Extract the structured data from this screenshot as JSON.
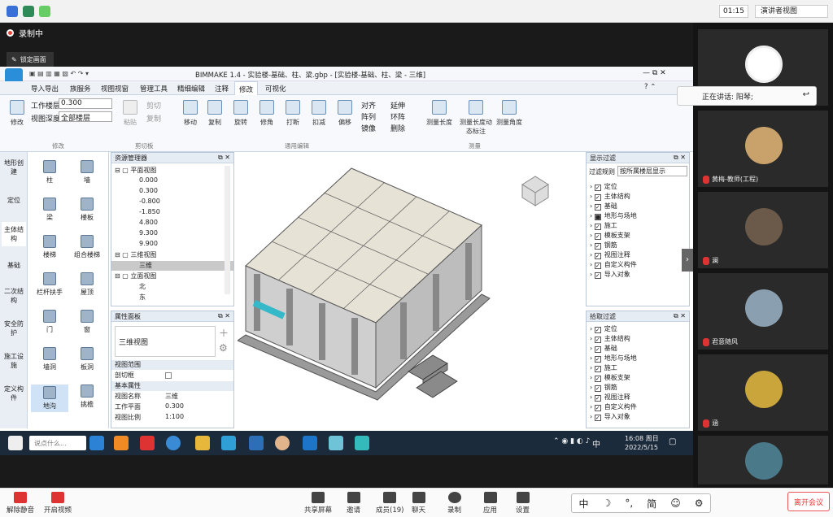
{
  "meeting": {
    "recording_label": "录制中",
    "lock_label": "锁定画面",
    "time": "01:15",
    "view_mode": "演讲者视图",
    "speaking_label": "正在讲话: 阳琴;",
    "leave_label": "离开会议",
    "chat_placeholder": "说点什么...",
    "bottom": {
      "mute": "解除静音",
      "video": "开启视频",
      "share": "共享屏幕",
      "invite": "邀请",
      "members": "成员(19)",
      "chat": "聊天",
      "record": "录制",
      "apps": "应用",
      "settings": "设置"
    },
    "ime": [
      "中",
      "☽",
      "°,",
      "简",
      "☺",
      "⚙"
    ],
    "participants": [
      {
        "name": "",
        "color": "#c0392b"
      },
      {
        "name": "黄梅-教师(工程)",
        "color": "#c8a26a"
      },
      {
        "name": "澜",
        "color": "#6b5a4a"
      },
      {
        "name": "君意随风",
        "color": "#8aa0b0"
      },
      {
        "name": "涵",
        "color": "#c9a53c"
      },
      {
        "name": "",
        "color": "#4a7a8a"
      }
    ]
  },
  "app": {
    "title": "BIMMAKE 1.4 - 实验楼-基础、柱、梁.gbp - [实验楼-基础、柱、梁 - 三维]",
    "menu": [
      "导入导出",
      "族服务",
      "视图视窗",
      "管理工具",
      "精细编辑",
      "注释",
      "修改",
      "可视化"
    ],
    "ribbon": {
      "modify": "修改",
      "work_layer_label": "工作楼层",
      "work_layer_value": "0.300",
      "view_depth_label": "视图深度",
      "view_depth_value": "全部楼层",
      "paste": "粘贴",
      "cut": "剪切",
      "copy_small": "复制",
      "tools": [
        "移动",
        "复制",
        "旋转",
        "修角",
        "打断",
        "扣减",
        "偏移"
      ],
      "edit_small": [
        "对齐",
        "阵列",
        "镜像",
        "延伸",
        "环阵",
        "删除"
      ],
      "measure": [
        "测量长度",
        "测量长度动态标注",
        "测量角度"
      ],
      "groups": [
        "修改",
        "剪切板",
        "通用编辑",
        "测量"
      ]
    },
    "vtabs": [
      "地形创建",
      "定位",
      "主体结构",
      "基础",
      "二次结构",
      "安全防护",
      "施工设施",
      "定义构件"
    ],
    "palette": [
      "柱",
      "墙",
      "梁",
      "楼板",
      "楼梯",
      "组合楼梯",
      "栏杆扶手",
      "屋顶",
      "门",
      "窗",
      "墙洞",
      "板洞",
      "地沟",
      "挑檐"
    ],
    "resource": {
      "title": "资源管理器",
      "plan": "平面视图",
      "levels": [
        "0.000",
        "0.300",
        "-0.800",
        "-1.850",
        "4.800",
        "9.300",
        "9.900"
      ],
      "threeD": "三维视图",
      "threeD_item": "三维",
      "elev": "立面视图",
      "elev_items": [
        "北",
        "东"
      ]
    },
    "props": {
      "title": "属性面板",
      "view_type": "三维视图",
      "section_view": "视图范围",
      "cut_box": "剖切框",
      "section_basic": "基本属性",
      "rows": [
        {
          "k": "视图名称",
          "v": "三维"
        },
        {
          "k": "工作平面",
          "v": "0.300"
        },
        {
          "k": "视图比例",
          "v": "1:100"
        }
      ]
    },
    "display_filter": {
      "title": "显示过滤",
      "rule_label": "过滤规则",
      "rule_value": "按所属楼层显示",
      "items": [
        "定位",
        "主体结构",
        "基础",
        "地形与场地",
        "施工",
        "模板支架",
        "钢筋",
        "视图注释",
        "自定义构件",
        "导入对象"
      ]
    },
    "pick_filter": {
      "title": "拾取过滤",
      "items": [
        "定位",
        "主体结构",
        "基础",
        "地形与场地",
        "施工",
        "模板支架",
        "钢筋",
        "视图注释",
        "自定义构件",
        "导入对象"
      ]
    }
  },
  "taskbar": {
    "time": "16:08 周日",
    "date": "2022/5/15",
    "ime": "中"
  }
}
